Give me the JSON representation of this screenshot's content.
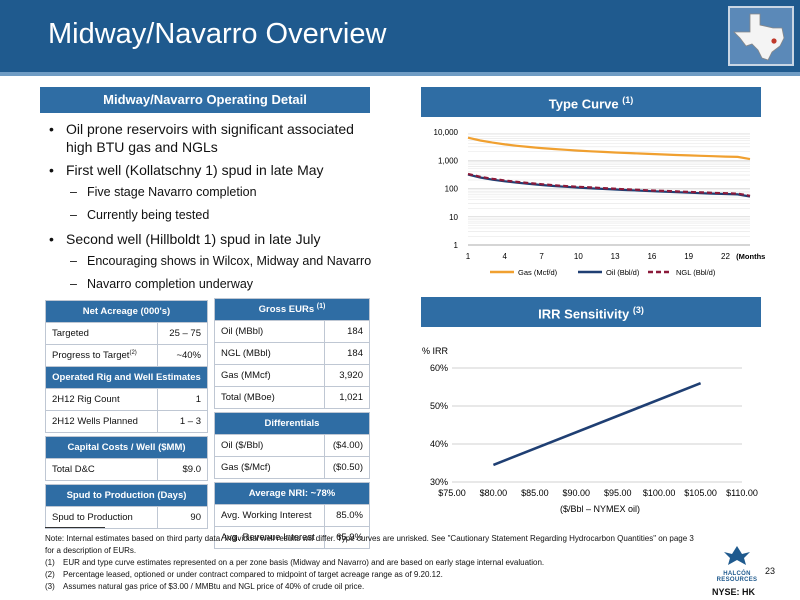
{
  "header": {
    "title": "Midway/Navarro Overview"
  },
  "operating_detail": {
    "heading": "Midway/Navarro Operating Detail",
    "bullets": [
      {
        "text": "Oil prone reservoirs with significant associated high BTU gas and NGLs",
        "subs": []
      },
      {
        "text": "First well (Kollatschny 1) spud in late May",
        "subs": [
          "Five stage Navarro completion",
          "Currently being tested"
        ]
      },
      {
        "text": "Second well (Hillboldt 1) spud in late July",
        "subs": [
          "Encouraging shows in Wilcox, Midway and Navarro",
          "Navarro completion underway"
        ]
      }
    ]
  },
  "type_curve": {
    "heading": "Type Curve",
    "heading_sup": "(1)",
    "y_ticks": [
      "10,000",
      "1,000",
      "100",
      "10",
      "1"
    ],
    "x_ticks": [
      "1",
      "4",
      "7",
      "10",
      "13",
      "16",
      "19",
      "22"
    ],
    "x_unit": "(Months)",
    "legend": [
      "Gas (Mcf/d)",
      "Oil (Bbl/d)",
      "NGL (Bbl/d)"
    ],
    "colors": {
      "gas": "#f0a030",
      "oil": "#1f3f73",
      "ngl": "#8b1a3a"
    }
  },
  "irr": {
    "heading": "IRR Sensitivity",
    "heading_sup": "(3)",
    "y_title": "% IRR",
    "y_ticks": [
      "60%",
      "50%",
      "40%",
      "30%"
    ],
    "x_ticks": [
      "$75.00",
      "$80.00",
      "$85.00",
      "$90.00",
      "$95.00",
      "$100.00",
      "$105.00",
      "$110.00"
    ],
    "x_title": "($/Bbl – NYMEX oil)",
    "color": "#1f3f73"
  },
  "chart_data": [
    {
      "type": "line",
      "title": "Type Curve (1)",
      "x_label": "(Months)",
      "y_scale": "log",
      "ylim": [
        1,
        10000
      ],
      "x": [
        1,
        2,
        3,
        4,
        5,
        6,
        7,
        8,
        9,
        10,
        11,
        12,
        13,
        14,
        15,
        16,
        17,
        18,
        19,
        20,
        21,
        22,
        23,
        24
      ],
      "series": [
        {
          "name": "Gas (Mcf/d)",
          "values": [
            6300,
            5000,
            4200,
            3650,
            3250,
            2950,
            2700,
            2500,
            2350,
            2200,
            2080,
            1980,
            1880,
            1800,
            1730,
            1660,
            1600,
            1540,
            1490,
            1440,
            1390,
            1350,
            1310,
            1100
          ]
        },
        {
          "name": "Oil (Bbl/d)",
          "values": [
            310,
            245,
            205,
            180,
            160,
            145,
            133,
            123,
            115,
            108,
            102,
            97,
            92,
            88,
            84,
            80,
            77,
            74,
            71,
            68,
            66,
            64,
            62,
            52
          ]
        },
        {
          "name": "NGL (Bbl/d)",
          "values": [
            330,
            260,
            220,
            192,
            171,
            155,
            142,
            131,
            122,
            115,
            109,
            103,
            98,
            93,
            89,
            85,
            82,
            79,
            76,
            73,
            70,
            68,
            66,
            55
          ]
        }
      ],
      "legend_position": "bottom",
      "grid": "horizontal"
    },
    {
      "type": "line",
      "title": "IRR Sensitivity (3)",
      "xlabel": "($/Bbl – NYMEX oil)",
      "ylabel": "% IRR",
      "xlim": [
        75,
        110
      ],
      "ylim": [
        30,
        60
      ],
      "x": [
        80,
        105
      ],
      "series": [
        {
          "values": [
            34.5,
            56
          ]
        }
      ],
      "grid": "horizontal"
    }
  ],
  "tables": {
    "net_acreage": {
      "header": "Net Acreage (000's)",
      "rows": [
        {
          "label": "Targeted",
          "value": "25 – 75"
        },
        {
          "label": "Progress to Target",
          "sup": "(2)",
          "value": "~40%"
        }
      ]
    },
    "rig": {
      "header": "Operated Rig and Well Estimates",
      "rows": [
        {
          "label": "2H12 Rig Count",
          "value": "1"
        },
        {
          "label": "2H12 Wells Planned",
          "value": "1 – 3"
        }
      ]
    },
    "capital": {
      "header": "Capital Costs / Well ($MM)",
      "rows": [
        {
          "label": "Total D&C",
          "value": "$9.0"
        }
      ]
    },
    "spud": {
      "header": "Spud to Production (Days)",
      "rows": [
        {
          "label": "Spud to Production",
          "value": "90"
        }
      ]
    },
    "gross_eurs": {
      "header": "Gross EURs",
      "header_sup": "(1)",
      "rows": [
        {
          "label": "Oil (MBbl)",
          "value": "184"
        },
        {
          "label": "NGL (MBbl)",
          "value": "184"
        },
        {
          "label": "Gas (MMcf)",
          "value": "3,920"
        },
        {
          "label": "Total (MBoe)",
          "value": "1,021"
        }
      ]
    },
    "differentials": {
      "header": "Differentials",
      "rows": [
        {
          "label": "Oil ($/Bbl)",
          "value": "($4.00)"
        },
        {
          "label": "Gas ($/Mcf)",
          "value": "($0.50)"
        }
      ]
    },
    "nri": {
      "header": "Average NRI: ~78%",
      "rows": [
        {
          "label": "Avg. Working Interest",
          "value": "85.0%"
        },
        {
          "label": "Avg. Revenue Interest",
          "value": "65.9%"
        }
      ]
    }
  },
  "footnotes": {
    "note": "Note: Internal estimates based on third party data. Individual well results will differ. Type curves are unrisked.  See \"Cautionary Statement Regarding Hydrocarbon Quantities\" on page 3 for a description of EURs.",
    "items": [
      {
        "num": "(1)",
        "text": "EUR and type curve estimates represented on a per zone basis (Midway and Navarro) and are based on early stage internal evaluation."
      },
      {
        "num": "(2)",
        "text": "Percentage leased, optioned or under contract compared to midpoint of target acreage range as of 9.20.12."
      },
      {
        "num": "(3)",
        "text": "Assumes natural gas price of $3.00 / MMBtu and NGL price of 40% of crude oil price."
      }
    ]
  },
  "footer": {
    "page_number": "23",
    "ticker": "NYSE: HK",
    "logo_text": "HALCÓN RESOURCES"
  }
}
